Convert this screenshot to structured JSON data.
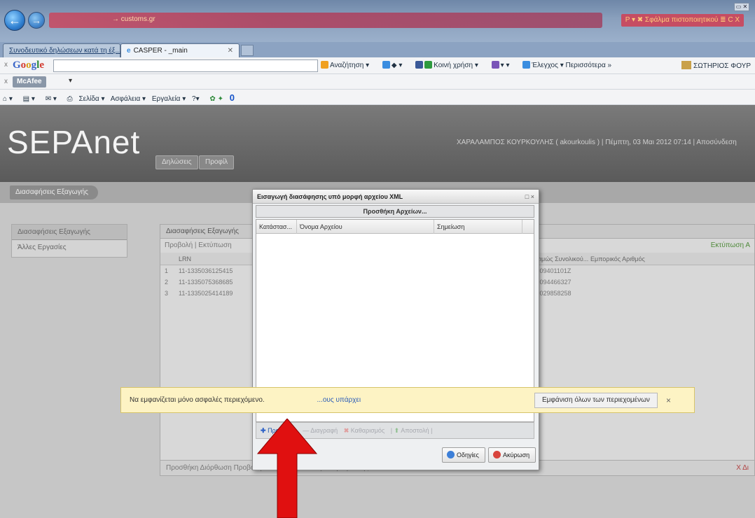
{
  "browser": {
    "address_text": "→ customs.gr",
    "address_tools": "Ρ ▾ ✖ Σφάλμα πιστοποιητικού ≣ C X",
    "tabs": [
      {
        "label": "Συνοδευτικό δηλώσεων κατά τη έξ..."
      },
      {
        "label": "CASPER - _main",
        "close": "✕"
      }
    ],
    "google": {
      "close": "x",
      "items": [
        "Αναζήτηση ▾",
        "◆ ▾",
        "Κοινή χρήση ▾",
        "▾ ▾",
        "Έλεγχος ▾ Περισσότερα »"
      ],
      "user": "ΣΩΤΗΡΙΟΣ ΦΟΥΡ"
    },
    "mcafee": {
      "close": "x",
      "label": "McAfee",
      "caret": "▾"
    },
    "commandbar": {
      "items": [
        "▾",
        "▾",
        "▾",
        "Σελίδα ▾",
        "Ασφάλεια ▾",
        "Εργαλεία ▾",
        "▾"
      ],
      "badge": "0"
    }
  },
  "app": {
    "logo": "SEPAnet",
    "header_tabs": [
      "Δηλώσεις",
      "Προφίλ"
    ],
    "user_info": "ΧΑΡΑΛΑΜΠΟΣ ΚΟΥΡΚΟΥΛΗΣ ( akourkoulis ) | Πέμπτη, 03 Μαι 2012 07:14 | Αποσύνδεση",
    "breadcrumb": "Διασαφήσεις Εξαγωγής",
    "sidebar": [
      {
        "label": "Διασαφήσεις Εξαγωγής"
      },
      {
        "label": "Άλλες Εργασίες"
      }
    ],
    "grid": {
      "title": "Διασαφήσεις Εξαγωγής",
      "tools": "Προβολή | Εκτύπωση",
      "tools_right": "Εκτύπωση Α",
      "headers": [
        "LRN",
        "Εκτιμώς Συνολικού...",
        "Εμπορικός Αριθμός"
      ],
      "rows": [
        {
          "num": "1",
          "lrn": "11-1335036125415",
          "ext": "GR09401101Z"
        },
        {
          "num": "2",
          "lrn": "11-1335075368685",
          "ext": "GR094466327"
        },
        {
          "num": "3",
          "lrn": "11-1335025414189",
          "ext": "GR029858258"
        }
      ],
      "bottom": "Προσθήκη  Διόρθωση  Προβολή από SEPAnet  Ακύρωση Δήλωσης",
      "bottom_right": "Χ Δι"
    }
  },
  "dialog": {
    "title": "Εισαγωγή διασάφησης υπό μορφή αρχείου XML",
    "controls": "□ ×",
    "upload_label": "Προσθήκη Αρχείων...",
    "columns": [
      "Κατάστασ...",
      "Όνομα Αρχείου",
      "Σημείωση"
    ],
    "footer": {
      "add": "Προσθήκη",
      "remove": "Διαγραφή",
      "cancel_upload": "Καθαρισμός",
      "upload": "Αποστολή"
    },
    "help_button": "Οδηγίες",
    "cancel_button": "Ακύρωση"
  },
  "notification": {
    "text": "Να εμφανίζεται μόνο ασφαλές περιεχόμενο.",
    "link": "...ους υπάρχει",
    "show_all": "Εμφάνιση όλων των περιεχομένων",
    "close": "×"
  },
  "colors": {
    "annotation_arrow": "#e01010",
    "logo_text": "#f4f4f4",
    "app_header": "#5a5a5a"
  }
}
